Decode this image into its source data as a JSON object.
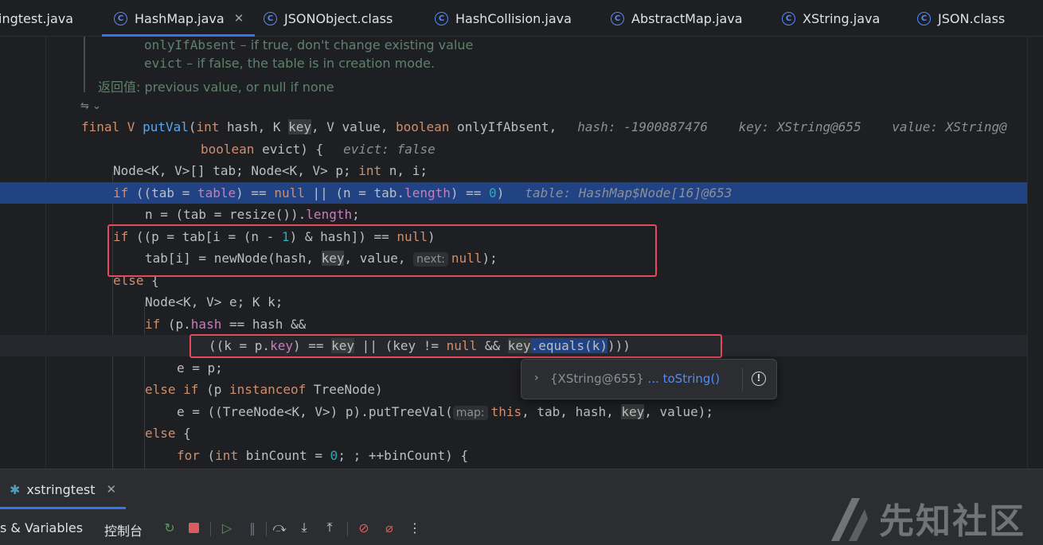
{
  "tabs": [
    {
      "label": "ingtest.java",
      "icon": "none",
      "active": false,
      "closable": false
    },
    {
      "label": "HashMap.java",
      "icon": "class-icon",
      "active": true,
      "closable": true
    },
    {
      "label": "JSONObject.class",
      "icon": "class-icon",
      "active": false,
      "closable": false
    },
    {
      "label": "HashCollision.java",
      "icon": "class-icon",
      "active": false,
      "closable": false
    },
    {
      "label": "AbstractMap.java",
      "icon": "class-icon",
      "active": false,
      "closable": false
    },
    {
      "label": "XString.java",
      "icon": "class-icon",
      "active": false,
      "closable": false
    },
    {
      "label": "JSON.class",
      "icon": "class-icon",
      "active": false,
      "closable": false
    }
  ],
  "doc": {
    "line1_code": "onlyIfAbsent",
    "line1_text": " – if true, don't change existing value",
    "line2_code": "evict",
    "line2_text": " – if false, the table is in creation mode.",
    "returns_label": "返回值:",
    "returns_text": " previous value, or null if none"
  },
  "code": {
    "l1_final": "final ",
    "l1_type": "V ",
    "l1_fn": "putVal",
    "l1_a": "(",
    "l1_int": "int",
    "l1_b": " hash, K ",
    "l1_key": "key",
    "l1_c": ", V value, ",
    "l1_bool": "boolean",
    "l1_d": " onlyIfAbsent,",
    "l1_inline": "hash: -1900887476    key: XString@655    value: XString@",
    "l2_bool": "boolean",
    "l2_a": " evict) {",
    "l2_inline": "evict: false",
    "l3_a": "Node<K, V>[] tab; Node<K, V> p; ",
    "l3_int": "int",
    "l3_b": " n, i;",
    "l4_if": "if",
    "l4_a": " ((tab = ",
    "l4_table": "table",
    "l4_b": ") == ",
    "l4_null1": "null",
    "l4_c": " || (n = tab.",
    "l4_length": "length",
    "l4_d": ") == ",
    "l4_zero": "0",
    "l4_e": ")",
    "l4_inline": "table: HashMap$Node[16]@653",
    "l5_a": "n = (tab = resize()).",
    "l5_length": "length",
    "l5_b": ";",
    "l6_if": "if",
    "l6_a": " ((p = tab[i = (n - ",
    "l6_one": "1",
    "l6_b": ") & hash]) == ",
    "l6_null": "null",
    "l6_c": ")",
    "l7_a": "tab[i] = newNode(hash, ",
    "l7_key": "key",
    "l7_b": ", value, ",
    "l7_hint": "next:",
    "l7_null": "null",
    "l7_c": ");",
    "l8_else": "else",
    "l8_a": " {",
    "l9_a": "Node<K, V> e; K k;",
    "l10_if": "if",
    "l10_a": " (p.",
    "l10_hash": "hash",
    "l10_b": " == hash &&",
    "l11_a": "((k = p.",
    "l11_key": "key",
    "l11_b": ") == ",
    "l11_key2": "key",
    "l11_c": " || (",
    "l11_key3": "key",
    "l11_d": " != ",
    "l11_null": "null",
    "l11_e": " && ",
    "l11_key4": "key",
    "l11_f": ".equals(k)",
    "l11_g": ")))",
    "l12_a": "e = p;",
    "l13_else": "else if",
    "l13_a": " (p ",
    "l13_inst": "instanceof",
    "l13_b": " TreeNode)",
    "l14_a": "e = ((TreeNode<K, V>) p).putTreeVal(",
    "l14_hint": "map:",
    "l14_this": "this",
    "l14_b": ", tab, hash, ",
    "l14_key": "key",
    "l14_c": ", value);",
    "l15_else": "else",
    "l15_a": " {",
    "l16_for": "for",
    "l16_a": " (",
    "l16_int": "int",
    "l16_b": " binCount = ",
    "l16_zero": "0",
    "l16_c": "; ; ++binCount) {"
  },
  "popup": {
    "value": "{XString@655}",
    "link": "... toString()"
  },
  "debug": {
    "session": "xstringtest",
    "threads_vars": "s & Variables",
    "console": "控制台",
    "tool_icons": [
      "rerun-icon",
      "stop-icon",
      "resume-icon",
      "pause-icon",
      "step-over-icon",
      "step-into-icon",
      "step-out-icon",
      "view-breakpoints-icon",
      "mute-breakpoints-icon",
      "more-icon"
    ]
  },
  "watermark": "先知社区",
  "colors": {
    "background": "#1e1f22",
    "exec_line": "#214283",
    "accent": "#3574f0",
    "keyword": "#cf8e6d",
    "annotation_box": "#e64a5a"
  }
}
